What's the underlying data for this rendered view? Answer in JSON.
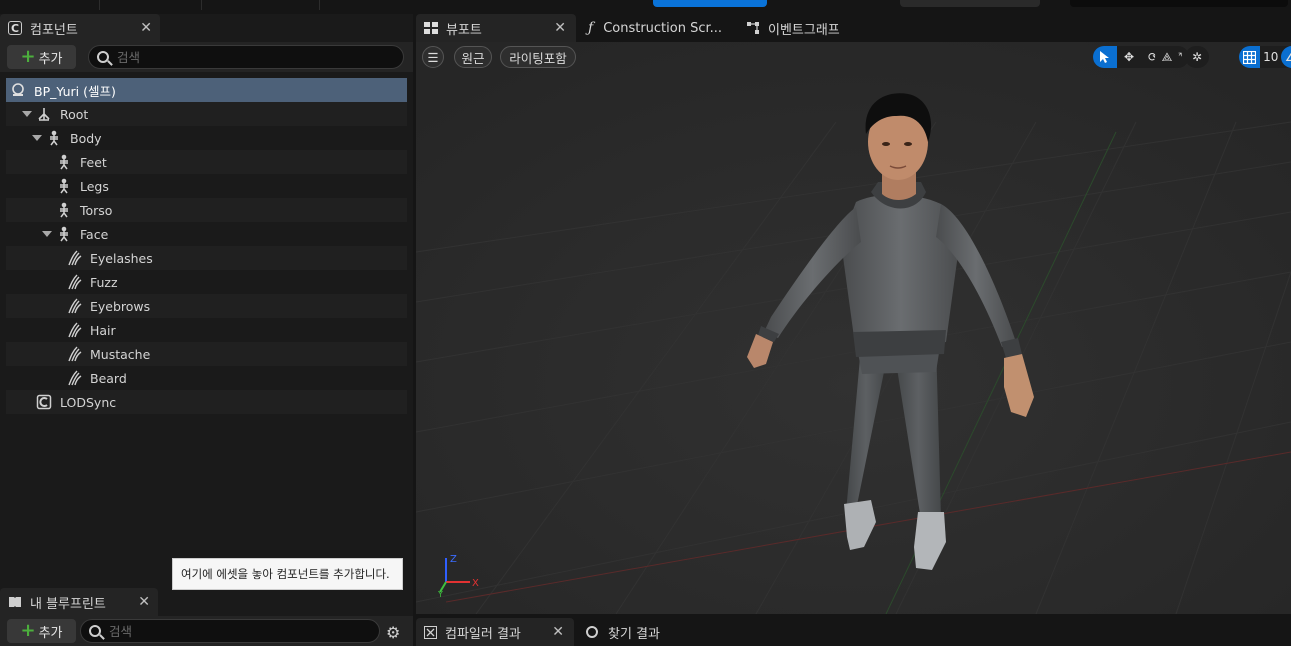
{
  "components_panel": {
    "tab_label": "컴포넌트",
    "add_label": "추가",
    "search_placeholder": "검색",
    "tree": [
      {
        "label": "BP_Yuri (셀프)",
        "icon": "blueprint-self-icon",
        "depth": 0,
        "expanded": null,
        "selected": true
      },
      {
        "label": "Root",
        "icon": "scene-root-icon",
        "depth": 1,
        "expanded": true
      },
      {
        "label": "Body",
        "icon": "skeletal-mesh-icon",
        "depth": 2,
        "expanded": true
      },
      {
        "label": "Feet",
        "icon": "skeletal-mesh-icon",
        "depth": 3
      },
      {
        "label": "Legs",
        "icon": "skeletal-mesh-icon",
        "depth": 3
      },
      {
        "label": "Torso",
        "icon": "skeletal-mesh-icon",
        "depth": 3
      },
      {
        "label": "Face",
        "icon": "skeletal-mesh-icon",
        "depth": 3,
        "expanded": true
      },
      {
        "label": "Eyelashes",
        "icon": "groom-icon",
        "depth": 4
      },
      {
        "label": "Fuzz",
        "icon": "groom-icon",
        "depth": 4
      },
      {
        "label": "Eyebrows",
        "icon": "groom-icon",
        "depth": 4
      },
      {
        "label": "Hair",
        "icon": "groom-icon",
        "depth": 4
      },
      {
        "label": "Mustache",
        "icon": "groom-icon",
        "depth": 4
      },
      {
        "label": "Beard",
        "icon": "groom-icon",
        "depth": 4
      },
      {
        "label": "LODSync",
        "icon": "component-icon",
        "depth": 1
      }
    ],
    "drop_tooltip": "여기에 에셋을 놓아 컴포넌트를 추가합니다."
  },
  "my_blueprint_panel": {
    "tab_label": "내 블루프린트",
    "add_label": "추가",
    "search_placeholder": "검색"
  },
  "editor_tabs": [
    {
      "label": "뷰포트",
      "icon": "viewport-grid-icon",
      "active": true
    },
    {
      "label": "Construction Scr...",
      "icon": "function-icon",
      "active": false
    },
    {
      "label": "이벤트그래프",
      "icon": "event-graph-icon",
      "active": false
    }
  ],
  "viewport": {
    "menu_icon": "hamburger-icon",
    "perspective_label": "원근",
    "lighting_label": "라이팅포함",
    "grid_snap_value": "10",
    "axis_labels": {
      "x": "X",
      "y": "Y",
      "z": "Z"
    }
  },
  "bottom_tabs": [
    {
      "label": "컴파일러 결과",
      "icon": "compiler-results-icon",
      "active": true
    },
    {
      "label": "찾기 결과",
      "icon": "search-icon",
      "active": false
    }
  ],
  "colors": {
    "accent_blue": "#0a73d9",
    "selection_row": "#4d6179",
    "add_plus": "#4caf3d"
  }
}
